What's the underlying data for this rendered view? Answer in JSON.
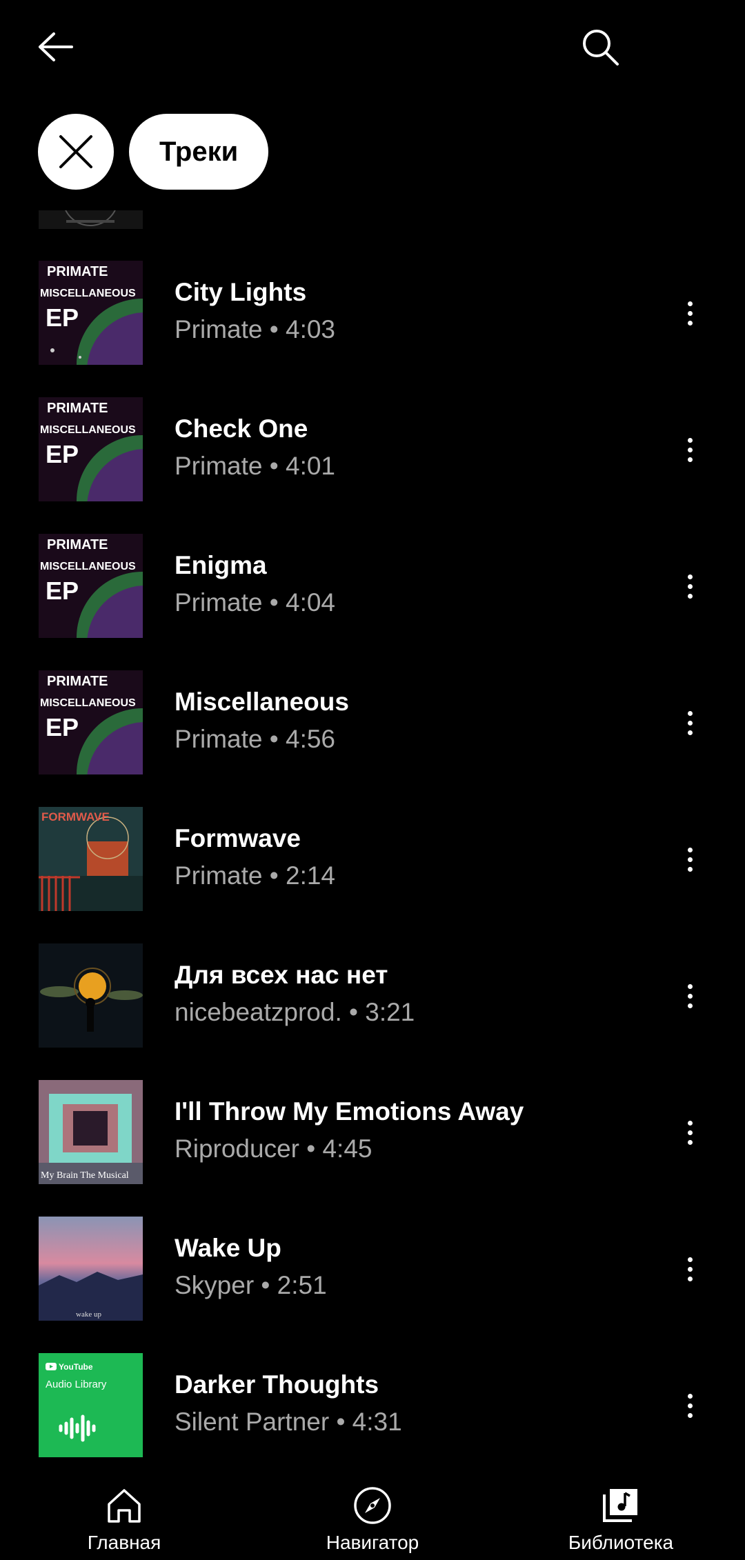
{
  "header": {
    "back_icon": "arrow-left-icon",
    "search_icon": "search-icon"
  },
  "filters": {
    "clear_icon": "close-icon",
    "active_chip": "Треки"
  },
  "tracks": [
    {
      "title": "City Lights",
      "subtitle": "Primate • 4:03"
    },
    {
      "title": "Check One",
      "subtitle": "Primate • 4:01"
    },
    {
      "title": "Enigma",
      "subtitle": "Primate • 4:04"
    },
    {
      "title": "Miscellaneous",
      "subtitle": "Primate • 4:56"
    },
    {
      "title": "Formwave",
      "subtitle": "Primate • 2:14"
    },
    {
      "title": "Для всех нас нет",
      "subtitle": "nicebeatzprod. • 3:21"
    },
    {
      "title": "I'll Throw My Emotions Away",
      "subtitle": "Riproducer • 4:45"
    },
    {
      "title": "Wake Up",
      "subtitle": "Skyper • 2:51"
    },
    {
      "title": "Darker Thoughts",
      "subtitle": "Silent Partner • 4:31"
    }
  ],
  "thumb_text": {
    "primate": "PRIMATE",
    "misc": "MISCELLANEOUS",
    "ep": "EP",
    "formwave": "FORMWAVE",
    "wakeup": "wake up",
    "mybrain": "My Brain The Musical",
    "yt": "YouTube",
    "audio_library": "Audio Library"
  },
  "nav": [
    {
      "label": "Главная",
      "icon": "home-icon"
    },
    {
      "label": "Навигатор",
      "icon": "compass-icon"
    },
    {
      "label": "Библиотека",
      "icon": "library-icon"
    }
  ],
  "colors": {
    "background": "#000000",
    "secondary_text": "#aaaaaa",
    "chip_bg": "#ffffff"
  }
}
